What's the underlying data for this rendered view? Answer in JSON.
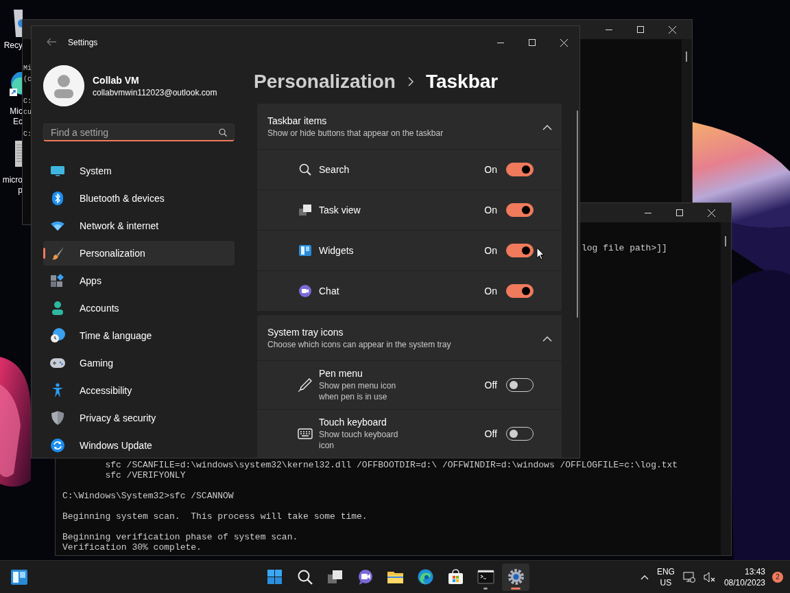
{
  "desktop": {
    "icons": [
      {
        "kind": "recycle-bin",
        "lines": [
          "Recy"
        ]
      },
      {
        "kind": "browser",
        "lines": [
          "Mic",
          "Ec"
        ]
      },
      {
        "kind": "document",
        "lines": [
          "micro",
          "p"
        ]
      }
    ]
  },
  "console_back": {
    "lines": [
      {
        "text": "Mi",
        "gap_before": false
      },
      {
        "text": "(c",
        "gap_before": false
      },
      {
        "text": "C:",
        "gap_before": true
      },
      {
        "text": "cu",
        "gap_before": false
      },
      {
        "text": "C:",
        "gap_before": true
      }
    ]
  },
  "console_front": {
    "top_text": "log file path>]]",
    "lines": [
      {
        "text": "        sfc /SCANFILE=d:\\windows\\system32\\kernel32.dll /OFFBOOTDIR=d:\\ /OFFWINDIR=d:\\windows /OFFLOGFILE=c:\\log.txt",
        "gap_before": false
      },
      {
        "text": "        sfc /VERIFYONLY",
        "gap_before": false
      },
      {
        "text": "C:\\Windows\\System32>sfc /SCANNOW",
        "gap_before": true
      },
      {
        "text": "Beginning system scan.  This process will take some time.",
        "gap_before": true
      },
      {
        "text": "Beginning verification phase of system scan.",
        "gap_before": true
      },
      {
        "text": "Verification 30% complete.",
        "gap_before": false
      }
    ]
  },
  "settings": {
    "title": "Settings",
    "user": {
      "name": "Collab VM",
      "email": "collabvmwin112023@outlook.com"
    },
    "search": {
      "placeholder": "Find a setting"
    },
    "nav": [
      {
        "label": "System",
        "kind": "system",
        "selected": false
      },
      {
        "label": "Bluetooth & devices",
        "kind": "bluetooth",
        "selected": false
      },
      {
        "label": "Network & internet",
        "kind": "network",
        "selected": false
      },
      {
        "label": "Personalization",
        "kind": "personalization",
        "selected": true
      },
      {
        "label": "Apps",
        "kind": "apps",
        "selected": false
      },
      {
        "label": "Accounts",
        "kind": "accounts",
        "selected": false
      },
      {
        "label": "Time & language",
        "kind": "time",
        "selected": false
      },
      {
        "label": "Gaming",
        "kind": "gaming",
        "selected": false
      },
      {
        "label": "Accessibility",
        "kind": "accessibility",
        "selected": false
      },
      {
        "label": "Privacy & security",
        "kind": "privacy",
        "selected": false
      },
      {
        "label": "Windows Update",
        "kind": "update",
        "selected": false
      }
    ],
    "breadcrumb": [
      "Personalization",
      "Taskbar"
    ],
    "sections": [
      {
        "title": "Taskbar items",
        "subtitle": "Show or hide buttons that appear on the taskbar",
        "expanded": true,
        "items": [
          {
            "label": "Search",
            "kind": "search",
            "state_label": "On",
            "on": true
          },
          {
            "label": "Task view",
            "kind": "taskview",
            "state_label": "On",
            "on": true
          },
          {
            "label": "Widgets",
            "kind": "widgets",
            "state_label": "On",
            "on": true
          },
          {
            "label": "Chat",
            "kind": "chat",
            "state_label": "On",
            "on": true
          }
        ]
      },
      {
        "title": "System tray icons",
        "subtitle": "Choose which icons can appear in the system tray",
        "expanded": true,
        "items": [
          {
            "label": "Pen menu",
            "description": "Show pen menu icon when pen is in use",
            "kind": "pen",
            "state_label": "Off",
            "on": false
          },
          {
            "label": "Touch keyboard",
            "description": "Show touch keyboard icon",
            "kind": "keyboard",
            "state_label": "Off",
            "on": false
          }
        ]
      }
    ]
  },
  "taskbar": {
    "apps": [
      {
        "kind": "start",
        "running": false,
        "active": false
      },
      {
        "kind": "search",
        "running": false,
        "active": false
      },
      {
        "kind": "taskview",
        "running": false,
        "active": false
      },
      {
        "kind": "chat",
        "running": false,
        "active": false
      },
      {
        "kind": "explorer",
        "running": false,
        "active": false
      },
      {
        "kind": "browser",
        "running": false,
        "active": false
      },
      {
        "kind": "store",
        "running": false,
        "active": false
      },
      {
        "kind": "terminal",
        "running": true,
        "active": false
      },
      {
        "kind": "settings",
        "running": true,
        "active": true
      }
    ],
    "language": [
      "ENG",
      "US"
    ],
    "time": "13:43",
    "date": "08/10/2023",
    "notifications": "2"
  }
}
